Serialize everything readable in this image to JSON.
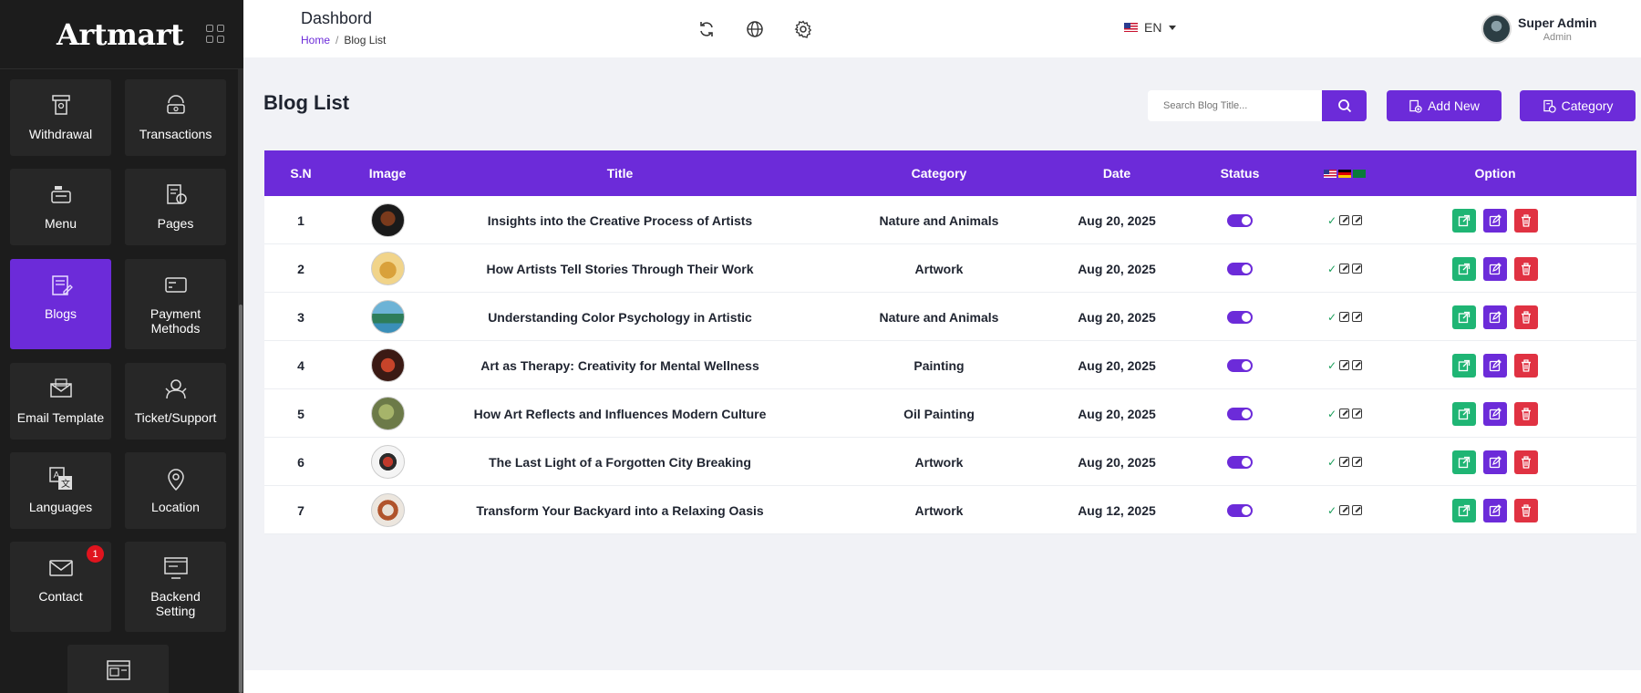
{
  "sidebar": {
    "logo": "Artmart",
    "items": [
      {
        "label": "Withdrawal",
        "icon": "atm-withdrawal-icon"
      },
      {
        "label": "Transactions",
        "icon": "transactions-icon"
      },
      {
        "label": "Menu",
        "icon": "menu-icon"
      },
      {
        "label": "Pages",
        "icon": "pages-icon"
      },
      {
        "label": "Blogs",
        "icon": "blogs-icon",
        "active": true
      },
      {
        "label": "Payment Methods",
        "icon": "payment-card-icon"
      },
      {
        "label": "Email Template",
        "icon": "email-template-icon"
      },
      {
        "label": "Ticket/Support",
        "icon": "support-icon"
      },
      {
        "label": "Languages",
        "icon": "language-translate-icon"
      },
      {
        "label": "Location",
        "icon": "location-pin-icon"
      },
      {
        "label": "Contact",
        "icon": "envelope-icon",
        "badge": "1"
      },
      {
        "label": "Backend Setting",
        "icon": "backend-setting-icon"
      },
      {
        "label": "",
        "icon": "website-icon"
      }
    ]
  },
  "header": {
    "title": "Dashbord",
    "breadcrumb": {
      "home": "Home",
      "separator": "/",
      "current": "Blog List"
    },
    "language": "EN",
    "user": {
      "name": "Super Admin",
      "role": "Admin"
    }
  },
  "main": {
    "page_title": "Blog List",
    "search_placeholder": "Search Blog Title...",
    "add_new_label": "Add New",
    "category_label": "Category",
    "table": {
      "headers": [
        "S.N",
        "Image",
        "Title",
        "Category",
        "Date",
        "Status",
        "",
        "Option"
      ],
      "rows": [
        {
          "sn": "1",
          "title": "Insights into the Creative Process of Artists",
          "category": "Nature and Animals",
          "date": "Aug 20, 2025"
        },
        {
          "sn": "2",
          "title": "How Artists Tell Stories Through Their Work",
          "category": "Artwork",
          "date": "Aug 20, 2025"
        },
        {
          "sn": "3",
          "title": "Understanding Color Psychology in Artistic",
          "category": "Nature and Animals",
          "date": "Aug 20, 2025"
        },
        {
          "sn": "4",
          "title": "Art as Therapy: Creativity for Mental Wellness",
          "category": "Painting",
          "date": "Aug 20, 2025"
        },
        {
          "sn": "5",
          "title": "How Art Reflects and Influences Modern Culture",
          "category": "Oil Painting",
          "date": "Aug 20, 2025"
        },
        {
          "sn": "6",
          "title": "The Last Light of a Forgotten City Breaking",
          "category": "Artwork",
          "date": "Aug 20, 2025"
        },
        {
          "sn": "7",
          "title": "Transform Your Backyard into a Relaxing Oasis",
          "category": "Artwork",
          "date": "Aug 12, 2025"
        }
      ]
    }
  },
  "colors": {
    "accent": "#6c2bd9",
    "sidebar_bg": "#1c1c1c",
    "view": "#1fb574",
    "delete": "#e03242",
    "badge": "#e0141e"
  }
}
